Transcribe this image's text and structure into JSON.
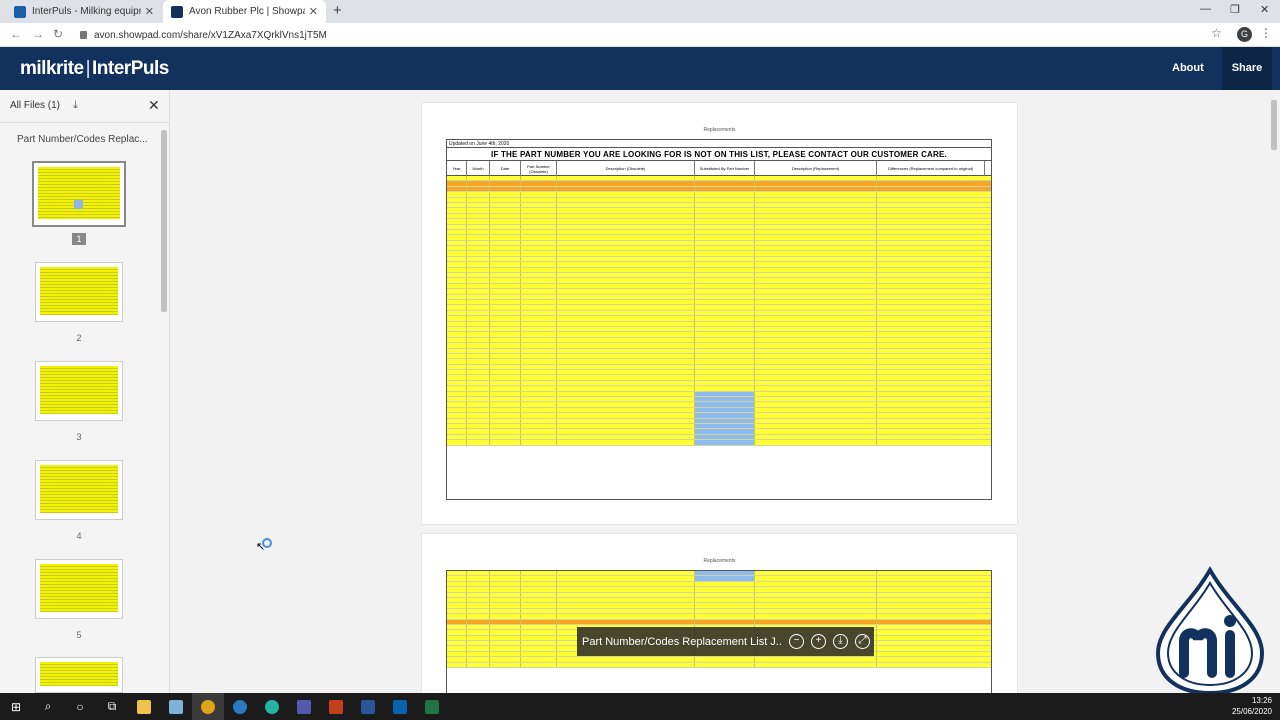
{
  "browser": {
    "tabs": [
      {
        "title": "InterPuls - Milking equipment co",
        "favicon_color": "#1a5fa8"
      },
      {
        "title": "Avon Rubber Plc | Showpad",
        "favicon_color": "#12325d"
      }
    ],
    "url": "avon.showpad.com/share/xV1ZAxa7XQrklVns1jT5M",
    "profile_initial": "G"
  },
  "header": {
    "logo_left": "milkrite",
    "logo_sep": "|",
    "logo_right": "InterPuls",
    "about_label": "About",
    "share_label": "Share"
  },
  "sidebar": {
    "heading": "All Files (1)",
    "document_title": "Part Number/Codes Replac...",
    "pages": [
      "1",
      "2",
      "3",
      "4",
      "5"
    ]
  },
  "viewer": {
    "page_caption": "Replacements",
    "updated_text": "Updated on June 4th, 2020",
    "banner_text": "IF THE PART NUMBER YOU ARE LOOKING FOR IS NOT ON THIS LIST, PLEASE CONTACT OUR CUSTOMER CARE.",
    "columns": [
      "Year",
      "Month",
      "Date",
      "Part Number (Obsolete)",
      "Description (Obsolete)",
      "Substituted By Part Number",
      "Description (Replacement)",
      "Differences (Replacement compared to original)"
    ],
    "toolbar_title": "Part Number/Codes Replacement List J..."
  },
  "taskbar": {
    "time": "13:26",
    "date": "25/06/2020"
  },
  "colors": {
    "header_bg": "#12325d",
    "row_yellow": "#ffff33",
    "row_orange": "#f5a623",
    "cell_blue": "#8ebbef"
  }
}
